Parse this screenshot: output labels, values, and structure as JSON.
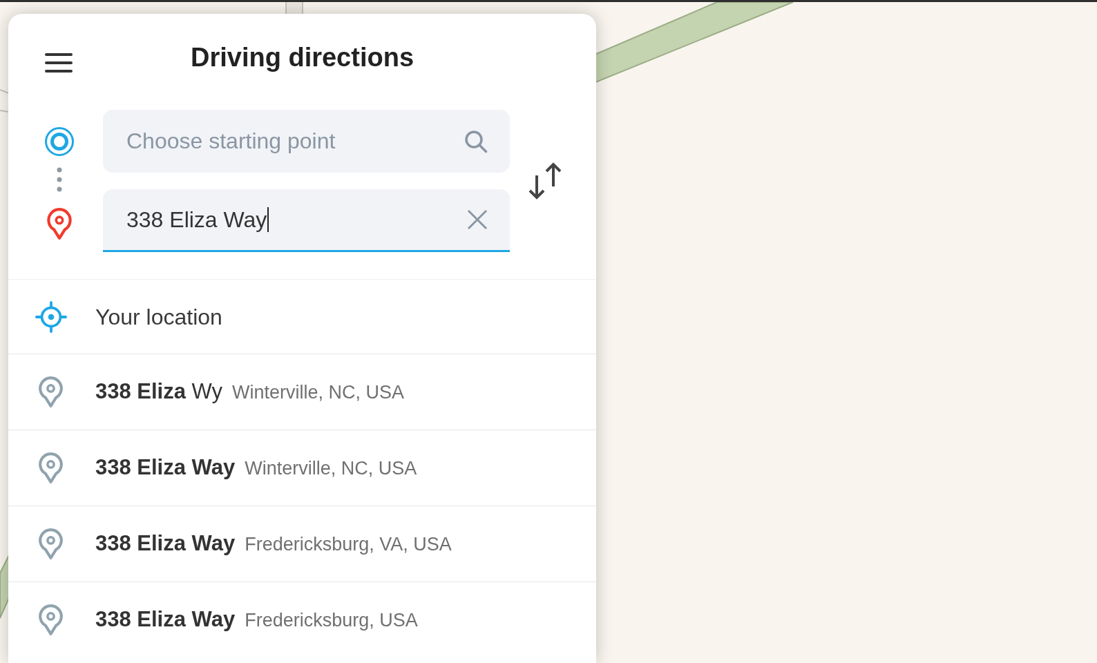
{
  "header": {
    "title": "Driving directions"
  },
  "route": {
    "origin": {
      "placeholder": "Choose starting point",
      "focused": false
    },
    "destination": {
      "value": "338 Eliza Way",
      "focused": true
    }
  },
  "suggestions": [
    {
      "kind": "current-location",
      "label": "Your location"
    },
    {
      "kind": "address",
      "label": "**338 Eliza** Wy",
      "detail": "Winterville, NC, USA"
    },
    {
      "kind": "address",
      "label": "**338 Eliza Way**",
      "detail": "Winterville, NC, USA"
    },
    {
      "kind": "address",
      "label": "**338 Eliza Way**",
      "detail": "Fredericksburg, VA, USA"
    },
    {
      "kind": "address",
      "label": "**338 Eliza Way**",
      "detail": "Fredericksburg, USA"
    }
  ]
}
